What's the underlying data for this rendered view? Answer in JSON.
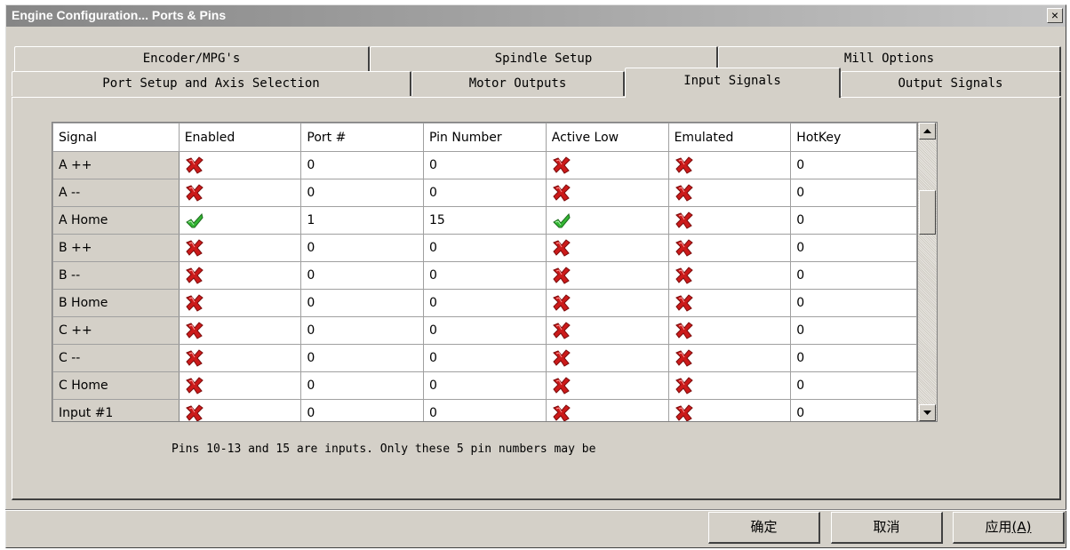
{
  "window": {
    "title": "Engine Configuration... Ports & Pins",
    "close_label": "×"
  },
  "tabs_row1": [
    {
      "label": "Encoder/MPG's"
    },
    {
      "label": "Spindle Setup"
    },
    {
      "label": "Mill Options"
    }
  ],
  "tabs_row2": [
    {
      "label": "Port Setup and Axis Selection"
    },
    {
      "label": "Motor Outputs"
    },
    {
      "label": "Input Signals",
      "active": true
    },
    {
      "label": "Output Signals"
    }
  ],
  "grid": {
    "columns": [
      "Signal",
      "Enabled",
      "Port #",
      "Pin Number",
      "Active Low",
      "Emulated",
      "HotKey"
    ],
    "rows": [
      {
        "signal": "A ++",
        "enabled": false,
        "port": "0",
        "pin": "0",
        "active_low": false,
        "emulated": false,
        "hotkey": "0"
      },
      {
        "signal": "A --",
        "enabled": false,
        "port": "0",
        "pin": "0",
        "active_low": false,
        "emulated": false,
        "hotkey": "0"
      },
      {
        "signal": "A Home",
        "enabled": true,
        "port": "1",
        "pin": "15",
        "active_low": true,
        "emulated": false,
        "hotkey": "0"
      },
      {
        "signal": "B ++",
        "enabled": false,
        "port": "0",
        "pin": "0",
        "active_low": false,
        "emulated": false,
        "hotkey": "0"
      },
      {
        "signal": "B --",
        "enabled": false,
        "port": "0",
        "pin": "0",
        "active_low": false,
        "emulated": false,
        "hotkey": "0"
      },
      {
        "signal": "B Home",
        "enabled": false,
        "port": "0",
        "pin": "0",
        "active_low": false,
        "emulated": false,
        "hotkey": "0"
      },
      {
        "signal": "C ++",
        "enabled": false,
        "port": "0",
        "pin": "0",
        "active_low": false,
        "emulated": false,
        "hotkey": "0"
      },
      {
        "signal": "C --",
        "enabled": false,
        "port": "0",
        "pin": "0",
        "active_low": false,
        "emulated": false,
        "hotkey": "0"
      },
      {
        "signal": "C Home",
        "enabled": false,
        "port": "0",
        "pin": "0",
        "active_low": false,
        "emulated": false,
        "hotkey": "0"
      },
      {
        "signal": "Input #1",
        "enabled": false,
        "port": "0",
        "pin": "0",
        "active_low": false,
        "emulated": false,
        "hotkey": "0"
      }
    ]
  },
  "note": "Pins 10-13 and 15 are inputs. Only these 5 pin numbers may be",
  "buttons": {
    "ok": "确定",
    "cancel": "取消",
    "apply": "应用",
    "apply_key": "(A)"
  },
  "icons": {
    "false_icon": "red-x-icon",
    "true_icon": "green-check-icon"
  },
  "colors": {
    "window_face": "#d4d0c8",
    "check": "#33b533",
    "cross": "#cc1a1a"
  }
}
